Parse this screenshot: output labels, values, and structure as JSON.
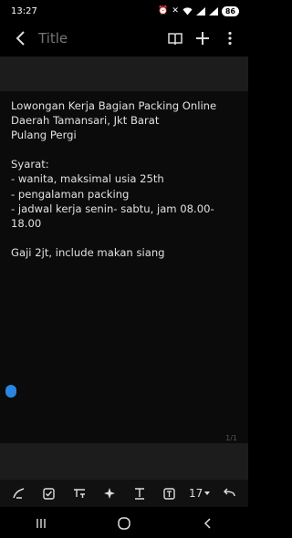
{
  "status": {
    "time": "13:27",
    "battery": "86"
  },
  "header": {
    "title": "Title",
    "back_icon": "chevron-left-icon",
    "actions": [
      "book-open-icon",
      "plus-icon",
      "more-vertical-icon"
    ]
  },
  "note": {
    "lines": [
      "Lowongan Kerja Bagian Packing Online",
      "Daerah Tamansari, Jkt Barat",
      "Pulang Pergi",
      "",
      "Syarat:",
      "- wanita, maksimal usia 25th",
      "- pengalaman packing",
      "- jadwal kerja senin- sabtu, jam 08.00-",
      "18.00",
      "",
      "Gaji 2jt, include makan siang"
    ],
    "page_indicator": "1/1"
  },
  "toolbar": {
    "font_size": "17",
    "items": [
      "pen-icon",
      "checkbox-icon",
      "text-format-icon",
      "ai-sparkle-icon",
      "text-style-icon",
      "text-box-icon",
      "font-size-selector",
      "undo-icon"
    ]
  },
  "colors": {
    "background": "#000000",
    "panel": "#1c1c1c",
    "text": "#e0e0e0",
    "title_placeholder": "#777777",
    "cursor": "#2a86e0"
  }
}
